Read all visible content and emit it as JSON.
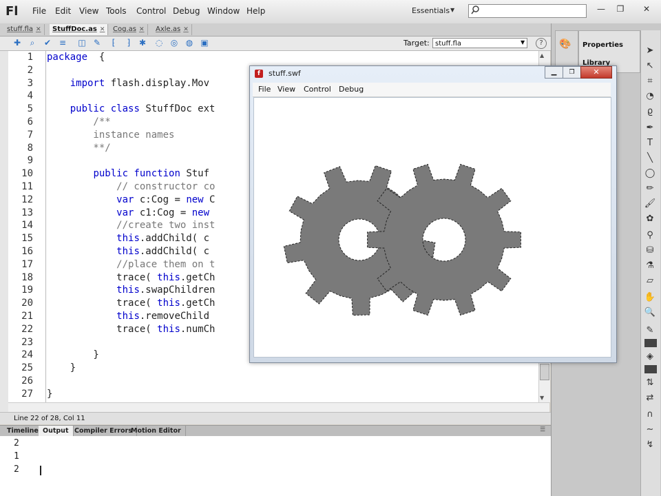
{
  "app": {
    "logo": "Fl",
    "menus": [
      "File",
      "Edit",
      "View",
      "Tools",
      "Control",
      "Debug",
      "Window",
      "Help"
    ],
    "workspace": "Essentials",
    "search_placeholder": "",
    "window_controls": [
      "—",
      "❐",
      "✕"
    ]
  },
  "doc_tabs": [
    {
      "label": "stuff.fla",
      "active": false
    },
    {
      "label": "StuffDoc.as",
      "active": true
    },
    {
      "label": "Cog.as",
      "active": false
    },
    {
      "label": "Axle.as",
      "active": false
    }
  ],
  "toolbar": {
    "target_label": "Target:",
    "target_value": "stuff.fla",
    "help": "?"
  },
  "editor": {
    "line_numbers": [
      "1",
      "2",
      "3",
      "4",
      "5",
      "6",
      "7",
      "8",
      "9",
      "10",
      "11",
      "12",
      "13",
      "14",
      "15",
      "16",
      "17",
      "18",
      "19",
      "20",
      "21",
      "22",
      "23",
      "24",
      "25",
      "26",
      "27"
    ],
    "lines": [
      "package  {",
      "",
      "    import flash.display.Mov",
      "",
      "    public class StuffDoc ext",
      "        /**",
      "        instance names",
      "        **/",
      "",
      "        public function Stuf",
      "            // constructor co",
      "            var c:Cog = new C",
      "            var c1:Cog = new",
      "            //create two inst",
      "            this.addChild( c",
      "            this.addChild( c",
      "            //place them on t",
      "            trace( this.getCh",
      "            this.swapChildren",
      "            trace( this.getCh",
      "            this.removeChild",
      "            trace( this.numCh",
      "",
      "        }",
      "    }",
      "",
      "}"
    ],
    "status": "Line 22 of 28, Col 11"
  },
  "panel": {
    "tabs": [
      {
        "label": "Timeline",
        "active": false
      },
      {
        "label": "Output",
        "active": true
      },
      {
        "label": "Compiler Errors",
        "active": false
      },
      {
        "label": "Motion Editor",
        "active": false
      }
    ],
    "output_lines": [
      "2",
      "1",
      "2"
    ]
  },
  "right_dock": {
    "properties": "Properties",
    "library": "Library"
  },
  "swf_window": {
    "title": "stuff.swf",
    "menus": [
      "File",
      "View",
      "Control",
      "Debug"
    ],
    "gear_color": "#7a7a7a"
  },
  "colors": {
    "keyword": "#0000cc",
    "comment": "#777777",
    "accent": "#2b6fc2",
    "close_button": "#c2392b"
  }
}
